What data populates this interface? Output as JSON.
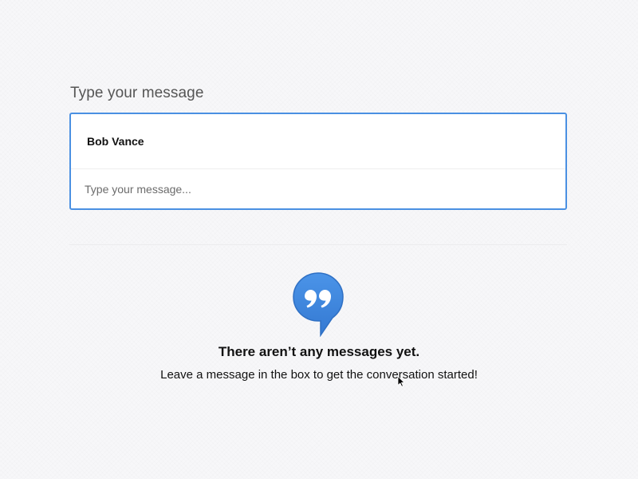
{
  "composer": {
    "heading": "Type your message",
    "recipient": "Bob Vance",
    "input_placeholder": "Type your message...",
    "input_value": "",
    "accent_color": "#4a90e2"
  },
  "empty_state": {
    "icon": "quote-bubble-icon",
    "icon_color": "#3d86dd",
    "title": "There aren’t any messages yet.",
    "subtitle": "Leave a message in the box to get the conversation started!"
  },
  "cursor": {
    "icon": "mouse-pointer-icon"
  }
}
